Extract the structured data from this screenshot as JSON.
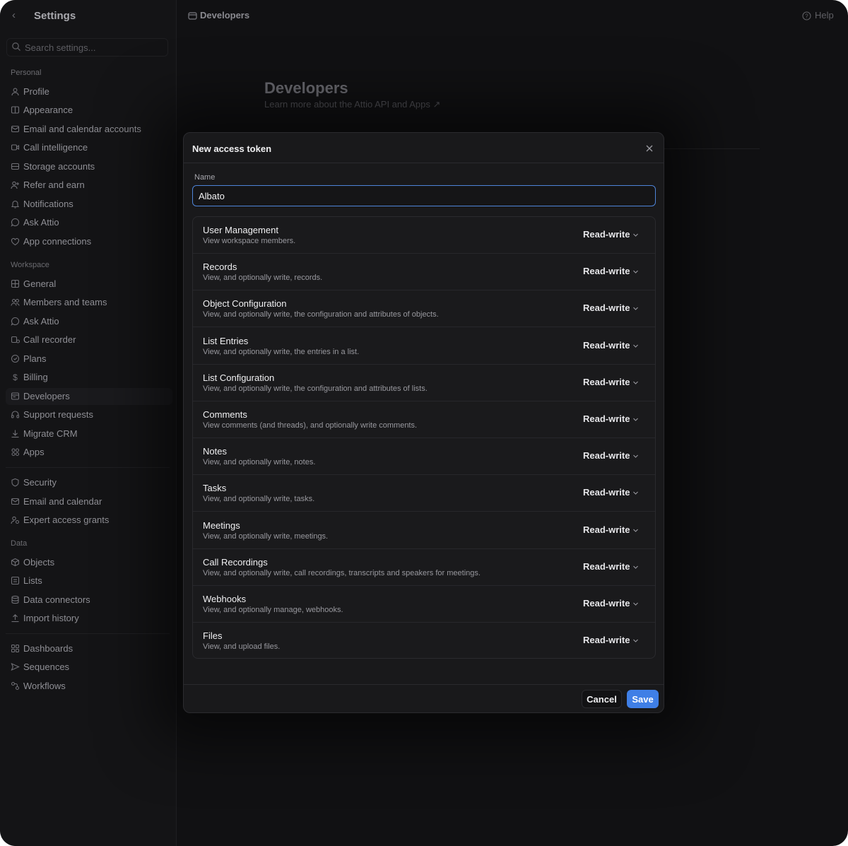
{
  "sidebar": {
    "title": "Settings",
    "search_placeholder": "Search settings...",
    "sections": {
      "personal": "Personal",
      "workspace": "Workspace",
      "data": "Data"
    },
    "personal_items": [
      {
        "label": "Profile",
        "icon": "user-icon"
      },
      {
        "label": "Appearance",
        "icon": "appearance-icon"
      },
      {
        "label": "Email and calendar accounts",
        "icon": "email-calendar-icon"
      },
      {
        "label": "Call intelligence",
        "icon": "video-icon"
      },
      {
        "label": "Storage accounts",
        "icon": "storage-icon"
      },
      {
        "label": "Refer and earn",
        "icon": "refer-icon"
      },
      {
        "label": "Notifications",
        "icon": "bell-icon"
      },
      {
        "label": "Ask Attio",
        "icon": "chat-icon"
      },
      {
        "label": "App connections",
        "icon": "plug-icon"
      }
    ],
    "workspace_items": [
      {
        "label": "General",
        "icon": "grid-icon"
      },
      {
        "label": "Members and teams",
        "icon": "users-icon"
      },
      {
        "label": "Ask Attio",
        "icon": "chat-icon"
      },
      {
        "label": "Call recorder",
        "icon": "recorder-icon"
      },
      {
        "label": "Plans",
        "icon": "plans-icon"
      },
      {
        "label": "Billing",
        "icon": "dollar-icon"
      },
      {
        "label": "Developers",
        "icon": "developers-icon"
      },
      {
        "label": "Support requests",
        "icon": "headset-icon"
      },
      {
        "label": "Migrate CRM",
        "icon": "download-icon"
      },
      {
        "label": "Apps",
        "icon": "apps-icon"
      }
    ],
    "security_items": [
      {
        "label": "Security",
        "icon": "shield-icon"
      },
      {
        "label": "Email and calendar",
        "icon": "mail-icon"
      },
      {
        "label": "Expert access grants",
        "icon": "expert-icon"
      }
    ],
    "data_items": [
      {
        "label": "Objects",
        "icon": "cube-icon"
      },
      {
        "label": "Lists",
        "icon": "list-icon"
      },
      {
        "label": "Data connectors",
        "icon": "database-icon"
      },
      {
        "label": "Import history",
        "icon": "upload-icon"
      }
    ],
    "extra_items": [
      {
        "label": "Dashboards",
        "icon": "dashboard-icon"
      },
      {
        "label": "Sequences",
        "icon": "send-icon"
      },
      {
        "label": "Workflows",
        "icon": "workflow-icon"
      }
    ],
    "active_item": "Developers"
  },
  "header": {
    "breadcrumb": "Developers",
    "help": "Help"
  },
  "page": {
    "title": "Developers",
    "subtitle": "Learn more about the Attio API and Apps ↗"
  },
  "modal": {
    "title": "New access token",
    "name_label": "Name",
    "name_value": "Albato",
    "permissions": [
      {
        "name": "User Management",
        "desc": "View workspace members.",
        "level": "Read-write"
      },
      {
        "name": "Records",
        "desc": "View, and optionally write, records.",
        "level": "Read-write"
      },
      {
        "name": "Object Configuration",
        "desc": "View, and optionally write, the configuration and attributes of objects.",
        "level": "Read-write"
      },
      {
        "name": "List Entries",
        "desc": "View, and optionally write, the entries in a list.",
        "level": "Read-write"
      },
      {
        "name": "List Configuration",
        "desc": "View, and optionally write, the configuration and attributes of lists.",
        "level": "Read-write"
      },
      {
        "name": "Comments",
        "desc": "View comments (and threads), and optionally write comments.",
        "level": "Read-write"
      },
      {
        "name": "Notes",
        "desc": "View, and optionally write, notes.",
        "level": "Read-write"
      },
      {
        "name": "Tasks",
        "desc": "View, and optionally write, tasks.",
        "level": "Read-write"
      },
      {
        "name": "Meetings",
        "desc": "View, and optionally write, meetings.",
        "level": "Read-write"
      },
      {
        "name": "Call Recordings",
        "desc": "View, and optionally write, call recordings, transcripts and speakers for meetings.",
        "level": "Read-write"
      },
      {
        "name": "Webhooks",
        "desc": "View, and optionally manage, webhooks.",
        "level": "Read-write"
      },
      {
        "name": "Files",
        "desc": "View, and upload files.",
        "level": "Read-write"
      }
    ],
    "cancel_label": "Cancel",
    "save_label": "Save"
  },
  "colors": {
    "accent": "#3f7fe6",
    "input_focus": "#4e84d8",
    "background": "#111113"
  }
}
